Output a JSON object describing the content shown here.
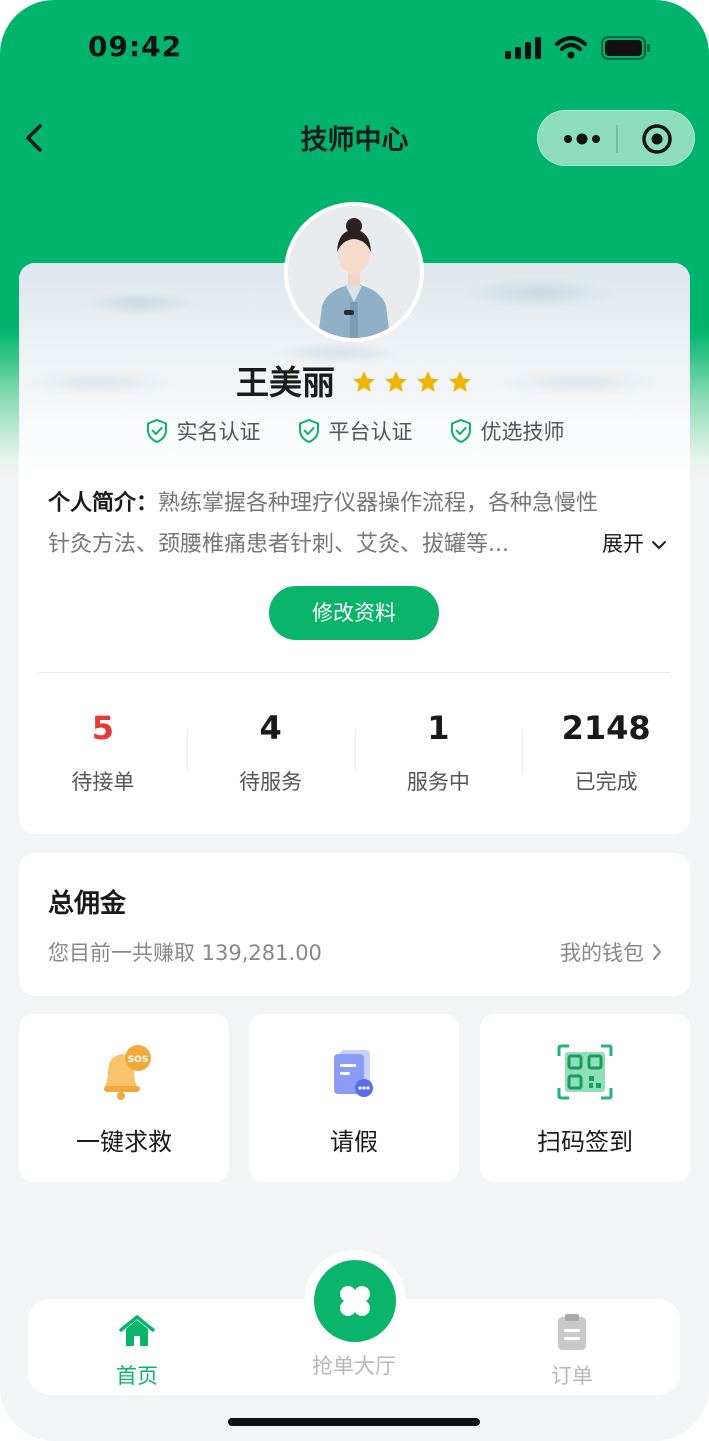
{
  "status_bar": {
    "time": "09:42"
  },
  "nav": {
    "title": "技师中心"
  },
  "profile": {
    "name": "王美丽",
    "rating_stars": 4,
    "badges": [
      {
        "label": "实名认证",
        "icon": "shield-check-icon"
      },
      {
        "label": "平台认证",
        "icon": "shield-check-icon"
      },
      {
        "label": "优选技师",
        "icon": "shield-check-icon"
      }
    ],
    "intro_label": "个人简介：",
    "intro_line1": "熟练掌握各种理疗仪器操作流程，各种急慢性",
    "intro_line2": "针灸方法、颈腰椎痛患者针刺、艾灸、拔罐等...",
    "expand_label": "展开",
    "edit_button": "修改资料"
  },
  "stats": [
    {
      "value": "5",
      "label": "待接单",
      "highlight": true
    },
    {
      "value": "4",
      "label": "待服务",
      "highlight": false
    },
    {
      "value": "1",
      "label": "服务中",
      "highlight": false
    },
    {
      "value": "2148",
      "label": "已完成",
      "highlight": false
    }
  ],
  "commission": {
    "title": "总佣金",
    "subtitle": "您目前一共赚取 139,281.00",
    "wallet_link": "我的钱包"
  },
  "actions": [
    {
      "label": "一键求救",
      "icon": "sos-bell-icon",
      "icon_text": "SOS"
    },
    {
      "label": "请假",
      "icon": "leave-document-icon"
    },
    {
      "label": "扫码签到",
      "icon": "qr-scan-icon"
    }
  ],
  "tabbar": {
    "home": "首页",
    "grab_hall": "抢单大厅",
    "orders": "订单"
  },
  "colors": {
    "brand_green": "#00b46e",
    "button_green": "#0bb46b",
    "star_yellow": "#f5b301",
    "highlight_red": "#e53935"
  }
}
